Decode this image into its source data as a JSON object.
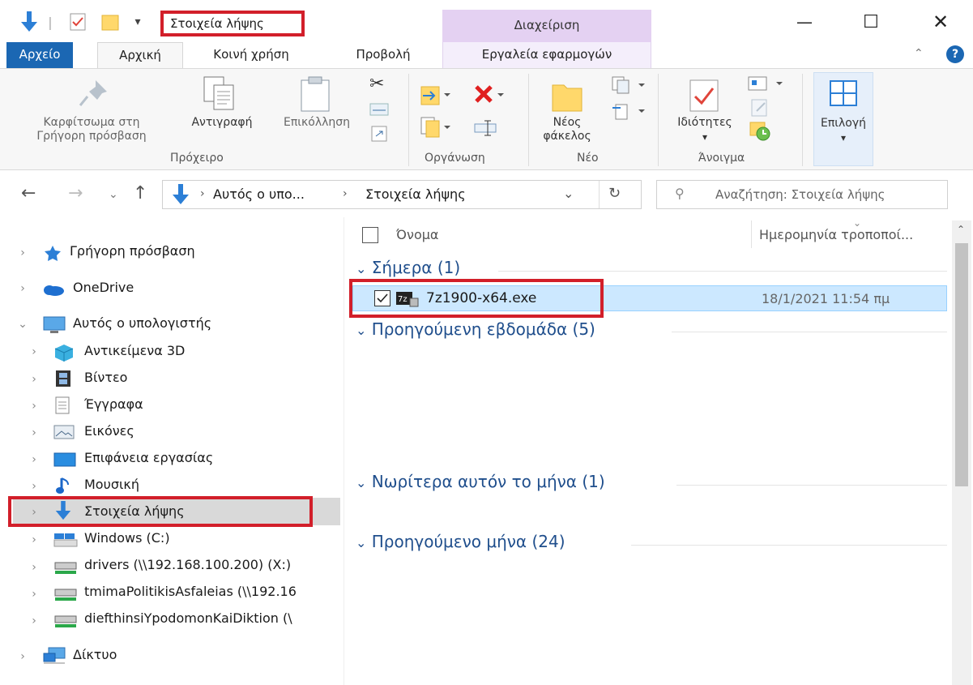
{
  "window": {
    "title": "Στοιχεία λήψης",
    "contextual_tab_group": "Διαχείριση",
    "minimize": "—",
    "maximize": "☐",
    "close": "✕"
  },
  "tabs": {
    "file": "Αρχείο",
    "home": "Αρχική",
    "share": "Κοινή χρήση",
    "view": "Προβολή",
    "app_tools": "Εργαλεία εφαρμογών"
  },
  "ribbon": {
    "pin_line1": "Καρφίτσωμα στη",
    "pin_line2": "Γρήγορη πρόσβαση",
    "copy": "Αντιγραφή",
    "paste": "Επικόλληση",
    "clipboard_group": "Πρόχειρο",
    "organize_group": "Οργάνωση",
    "new_folder_line1": "Νέος",
    "new_folder_line2": "φάκελος",
    "new_group": "Νέο",
    "properties": "Ιδιότητες",
    "open_group": "Άνοιγμα",
    "select": "Επιλογή"
  },
  "address": {
    "crumb1": "Αυτός ο υπο...",
    "crumb2": "Στοιχεία λήψης",
    "search_placeholder": "Αναζήτηση: Στοιχεία λήψης"
  },
  "nav": {
    "quick_access": "Γρήγορη πρόσβαση",
    "onedrive": "OneDrive",
    "this_pc": "Αυτός ο υπολογιστής",
    "objects3d": "Αντικείμενα 3D",
    "videos": "Βίντεο",
    "documents": "Έγγραφα",
    "pictures": "Εικόνες",
    "desktop": "Επιφάνεια εργασίας",
    "music": "Μουσική",
    "downloads": "Στοιχεία λήψης",
    "windows_c": "Windows (C:)",
    "drivers": "drivers (\\\\192.168.100.200) (X:)",
    "tmima": "tmimaPolitikisAsfaleias (\\\\192.16",
    "diefthinsi": "diefthinsiYpodomonKaiDiktion (\\",
    "network": "Δίκτυο"
  },
  "list": {
    "col_name": "Όνομα",
    "col_date": "Ημερομηνία τροποποί...",
    "groups": {
      "today": "Σήμερα (1)",
      "last_week": "Προηγούμενη εβδομάδα (5)",
      "earlier_month": "Νωρίτερα αυτόν το μήνα (1)",
      "last_month": "Προηγούμενο μήνα (24)"
    },
    "file": {
      "name": "7z1900-x64.exe",
      "date": "18/1/2021 11:54 πμ"
    }
  },
  "colors": {
    "highlight_red": "#d21f2a",
    "file_tab_blue": "#1b67b3",
    "selection_bg": "#cce8ff",
    "manage_purple": "#e4d1f2"
  }
}
